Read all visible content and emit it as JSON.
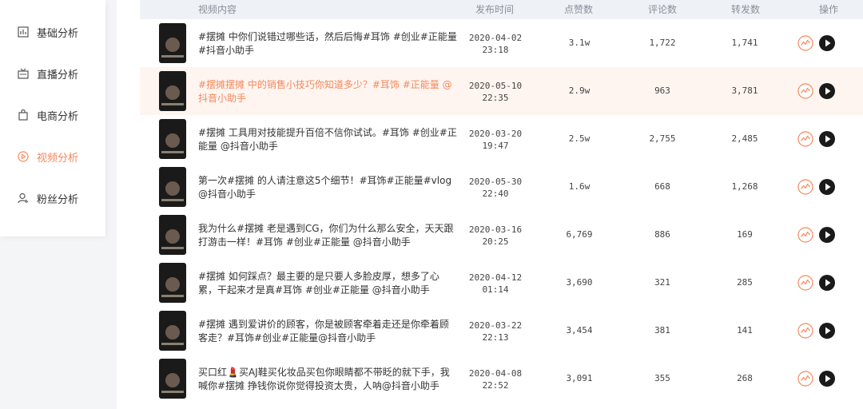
{
  "sidebar": {
    "items": [
      {
        "label": "基础分析",
        "icon": "bar-chart-icon",
        "active": false
      },
      {
        "label": "直播分析",
        "icon": "tv-icon",
        "active": false
      },
      {
        "label": "电商分析",
        "icon": "shopping-bag-icon",
        "active": false
      },
      {
        "label": "视频分析",
        "icon": "play-circle-icon",
        "active": true
      },
      {
        "label": "粉丝分析",
        "icon": "user-icon",
        "active": false
      }
    ]
  },
  "table": {
    "headers": {
      "content": "视频内容",
      "time": "发布时间",
      "likes": "点赞数",
      "comments": "评论数",
      "shares": "转发数",
      "ops": "操作"
    },
    "rows": [
      {
        "content": "#摆摊 中你们说错过哪些话，然后后悔#耳饰 #创业#正能量#抖音小助手",
        "date": "2020-04-02",
        "clock": "23:18",
        "likes": "3.1w",
        "comments": "1,722",
        "shares": "1,741",
        "highlight": false
      },
      {
        "content": "#摆摊摆摊 中的销售小技巧你知道多少？#耳饰 #正能量 @抖音小助手",
        "date": "2020-05-10",
        "clock": "22:35",
        "likes": "2.9w",
        "comments": "963",
        "shares": "3,781",
        "highlight": true
      },
      {
        "content": "#摆摊 工具用对技能提升百倍不信你试试。#耳饰 #创业#正能量 @抖音小助手",
        "date": "2020-03-20",
        "clock": "19:47",
        "likes": "2.5w",
        "comments": "2,755",
        "shares": "2,485",
        "highlight": false
      },
      {
        "content": "第一次#摆摊 的人请注意这5个细节！#耳饰#正能量#vlog @抖音小助手",
        "date": "2020-05-30",
        "clock": "22:40",
        "likes": "1.6w",
        "comments": "668",
        "shares": "1,268",
        "highlight": false
      },
      {
        "content": "我为什么#摆摊 老是遇到CG，你们为什么那么安全，天天跟打游击一样！#耳饰 #创业#正能量 @抖音小助手",
        "date": "2020-03-16",
        "clock": "20:25",
        "likes": "6,769",
        "comments": "886",
        "shares": "169",
        "highlight": false
      },
      {
        "content": "#摆摊 如何踩点？最主要的是只要人多脸皮厚，想多了心累，干起来才是真#耳饰 #创业#正能量 @抖音小助手",
        "date": "2020-04-12",
        "clock": "01:14",
        "likes": "3,690",
        "comments": "321",
        "shares": "285",
        "highlight": false
      },
      {
        "content": "#摆摊 遇到爱讲价的顾客，你是被顾客牵着走还是你牵着顾客走？#耳饰#创业#正能量@抖音小助手",
        "date": "2020-03-22",
        "clock": "22:13",
        "likes": "3,454",
        "comments": "381",
        "shares": "141",
        "highlight": false
      },
      {
        "content": "买口红💄买AJ鞋买化妆品买包你眼睛都不带眨的就下手，我喊你#摆摊 挣钱你说你觉得投资太贵，人呐@抖音小助手",
        "date": "2020-04-08",
        "clock": "22:52",
        "likes": "3,091",
        "comments": "355",
        "shares": "268",
        "highlight": false
      }
    ]
  },
  "colors": {
    "accent": "#f4885d",
    "highlight_row": "#fff5f0",
    "header_bg": "#eef1f6"
  },
  "op_icons": {
    "trend": "trend-chart-icon",
    "play": "play-icon"
  }
}
